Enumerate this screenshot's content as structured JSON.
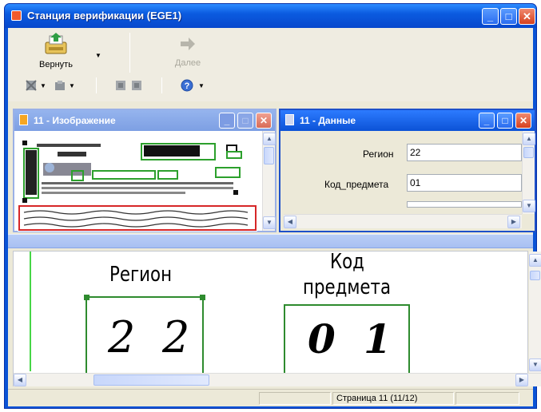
{
  "window": {
    "title": "Станция верификации (EGE1)"
  },
  "toolbar": {
    "return_label": "Вернуть",
    "next_label": "Далее"
  },
  "image_panel": {
    "title": "11 - Изображение"
  },
  "data_panel": {
    "title": "11 - Данные",
    "fields": [
      {
        "label": "Регион",
        "value": "22"
      },
      {
        "label": "Код_предмета",
        "value": "01"
      }
    ]
  },
  "zoom_view": {
    "region_label": "Регион",
    "region_digits": [
      "2",
      "2"
    ],
    "subject_label_line1": "Код",
    "subject_label_line2": "предмета",
    "subject_digits": [
      "0",
      "1"
    ]
  },
  "status": {
    "page": "Страница 11  (11/12)"
  },
  "colors": {
    "title_blue": "#0b5be0",
    "panel_border": "#7a9ce8",
    "green_box": "#2e8b2e"
  }
}
